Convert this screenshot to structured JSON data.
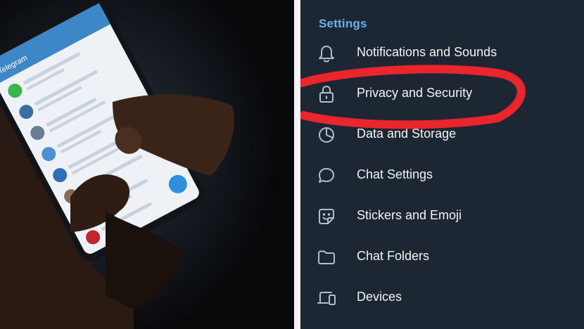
{
  "settings": {
    "section_title": "Settings",
    "items": [
      {
        "label": "Notifications and Sounds",
        "icon": "bell-icon"
      },
      {
        "label": "Privacy and Security",
        "icon": "lock-icon"
      },
      {
        "label": "Data and Storage",
        "icon": "pie-chart-icon"
      },
      {
        "label": "Chat Settings",
        "icon": "chat-bubble-icon"
      },
      {
        "label": "Stickers and Emoji",
        "icon": "sticker-icon"
      },
      {
        "label": "Chat Folders",
        "icon": "folder-icon"
      },
      {
        "label": "Devices",
        "icon": "devices-icon"
      }
    ],
    "highlight_color": "#e8262b"
  },
  "photo": {
    "app_header": "Telegram",
    "accent_color": "#2f8fdc"
  }
}
